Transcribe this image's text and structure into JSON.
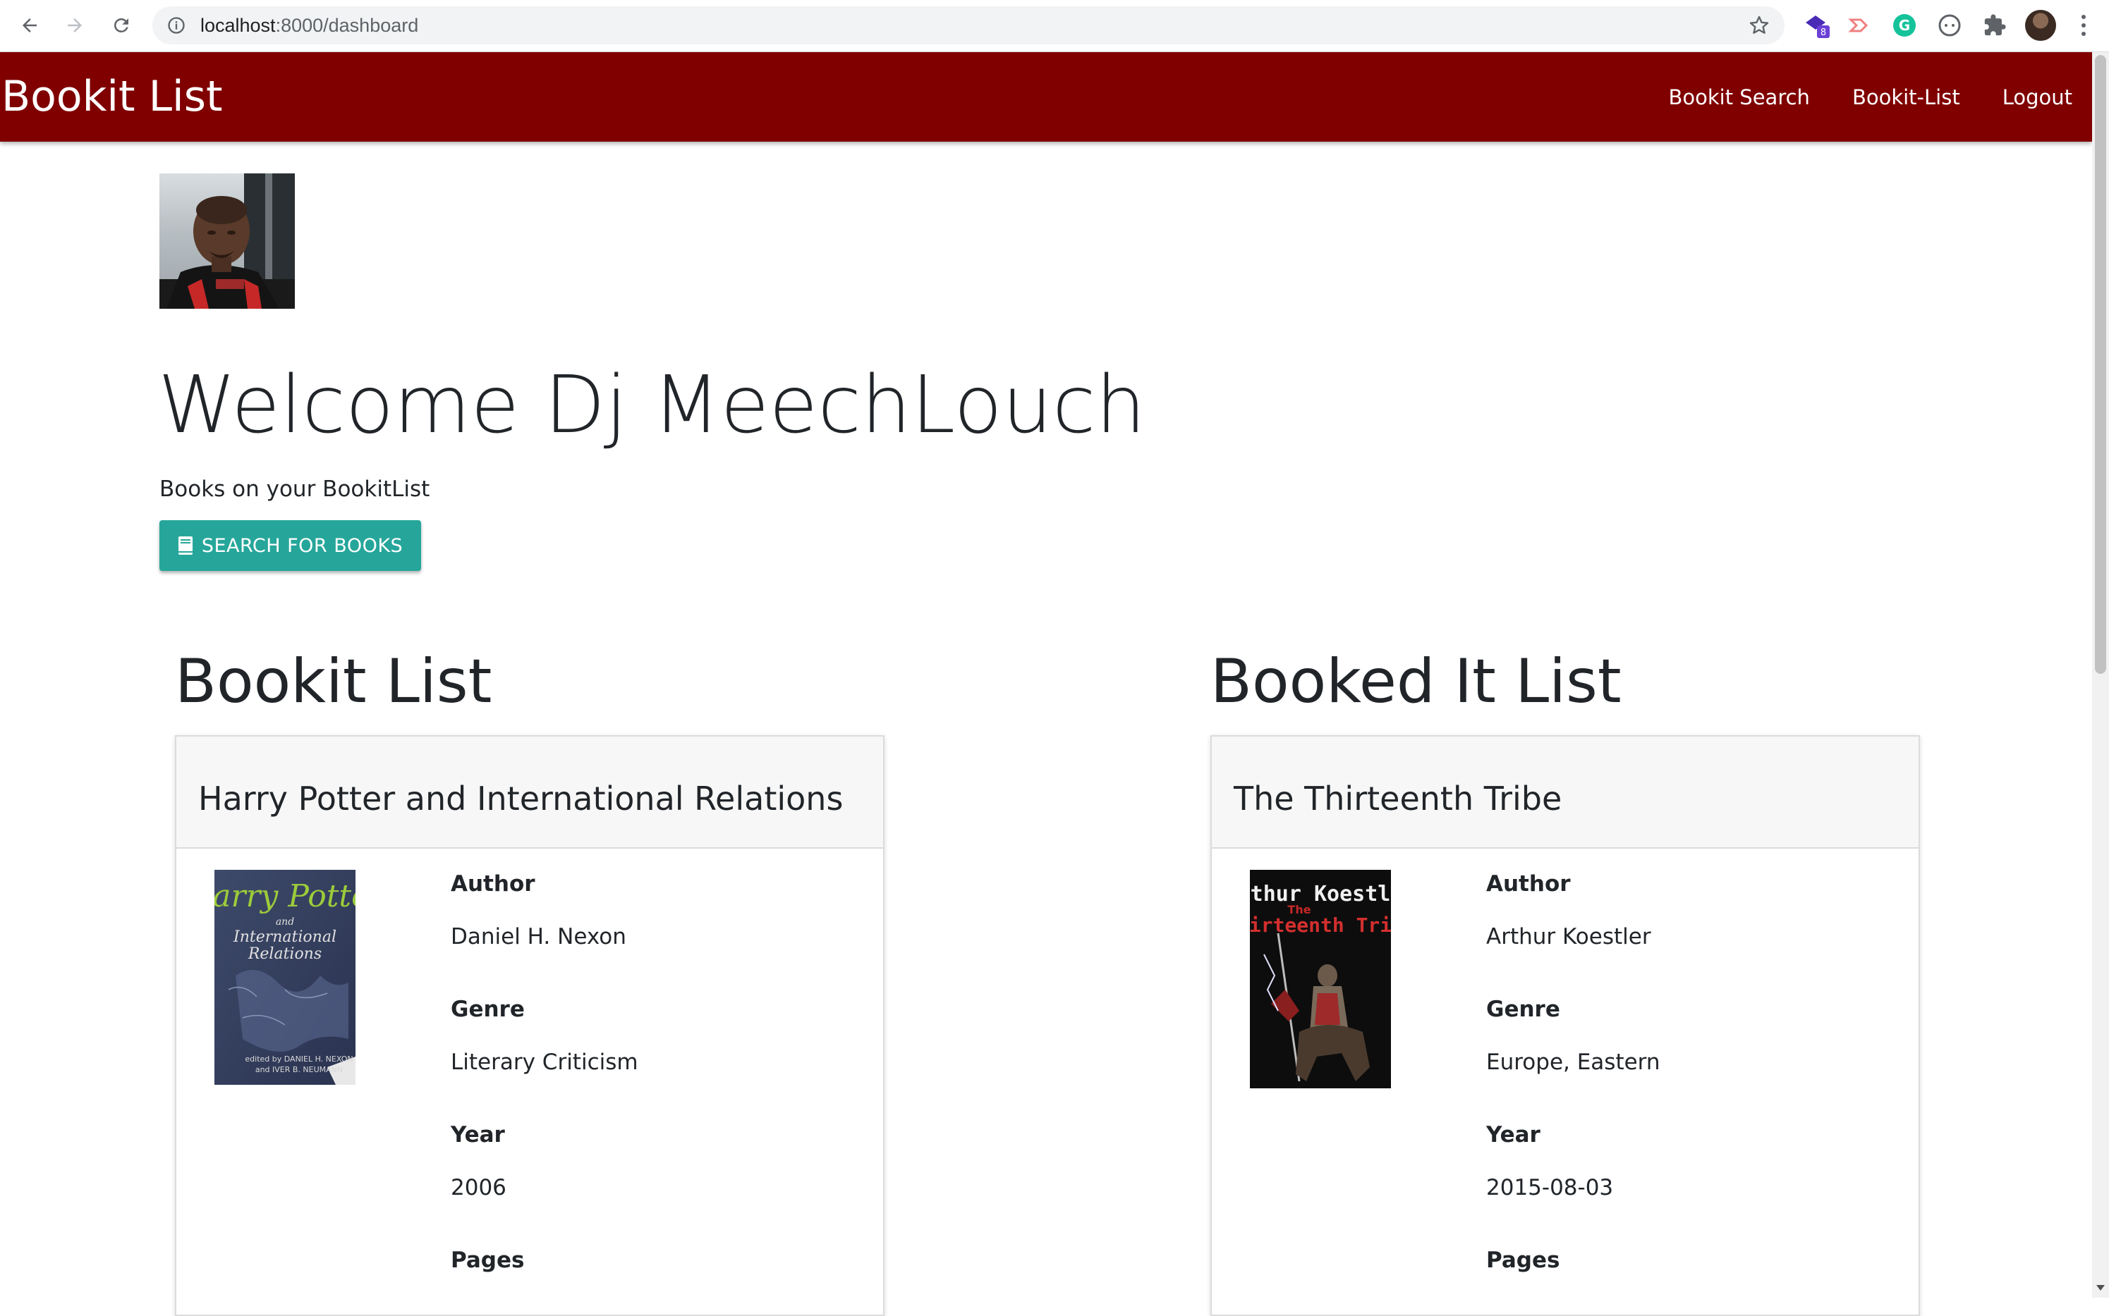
{
  "browser": {
    "url_host": "localhost",
    "url_path": ":8000/dashboard",
    "extension_badge": "8"
  },
  "navbar": {
    "brand": "Bookit List",
    "links": [
      "Bookit Search",
      "Bookit-List",
      "Logout"
    ],
    "color": "#800000"
  },
  "main": {
    "welcome": "Welcome Dj MeechLouch",
    "subtitle": "Books on your BookitList",
    "search_button": "SEARCH FOR BOOKS",
    "button_color": "#26a69a"
  },
  "bookit_list": {
    "heading": "Bookit List",
    "book": {
      "title": "Harry Potter and International Relations",
      "cover_text": [
        "Harry Potter",
        "and",
        "International",
        "Relations"
      ],
      "cover_credit": [
        "edited by DANIEL H. NEXON",
        "and IVER B. NEUMANN"
      ],
      "fields": [
        {
          "label": "Author",
          "value": "Daniel H. Nexon"
        },
        {
          "label": "Genre",
          "value": "Literary Criticism"
        },
        {
          "label": "Year",
          "value": "2006"
        },
        {
          "label": "Pages",
          "value": ""
        }
      ]
    }
  },
  "booked_it_list": {
    "heading": "Booked It List",
    "book": {
      "title": "The Thirteenth Tribe",
      "cover_text": [
        "Arthur Koestler",
        "The",
        "Thirteenth Tribe"
      ],
      "fields": [
        {
          "label": "Author",
          "value": "Arthur Koestler"
        },
        {
          "label": "Genre",
          "value": "Europe, Eastern"
        },
        {
          "label": "Year",
          "value": "2015-08-03"
        },
        {
          "label": "Pages",
          "value": ""
        }
      ]
    }
  }
}
